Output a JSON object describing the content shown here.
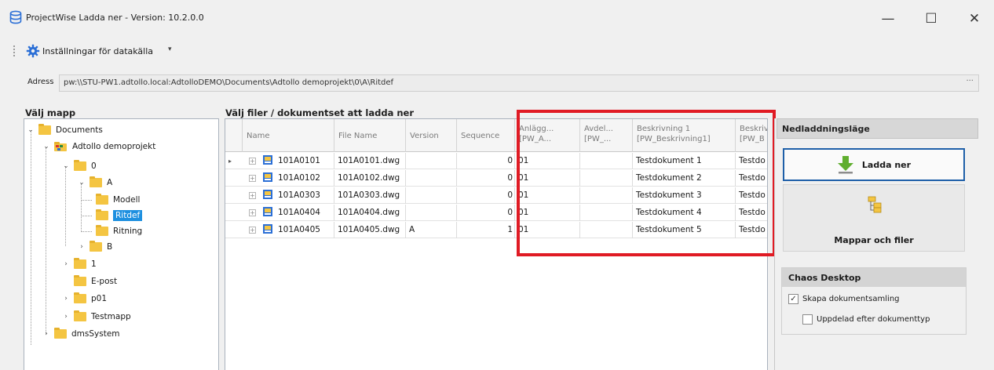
{
  "window": {
    "title": "ProjectWise Ladda ner - Version: 10.2.0.0",
    "minimize_glyph": "—",
    "maximize_glyph": "☐",
    "close_glyph": "✕"
  },
  "toolbar": {
    "settings_label": "Inställningar för datakälla",
    "dropdown_glyph": "▾"
  },
  "address": {
    "label": "Adress",
    "value": "pw:\\\\STU-PW1.adtollo.local:AdtolloDEMO\\Documents\\Adtollo demoprojekt\\0\\A\\Ritdef",
    "more_glyph": "···"
  },
  "tree": {
    "header": "Välj mapp",
    "items": [
      {
        "label": "Documents",
        "expander": "⌄",
        "icon": "folder-icon"
      },
      {
        "label": "Adtollo demoprojekt",
        "expander": "⌄",
        "icon": "project-icon"
      },
      {
        "label": "0",
        "expander": "⌄",
        "icon": "folder-icon"
      },
      {
        "label": "A",
        "expander": "⌄",
        "icon": "folder-icon"
      },
      {
        "label": "Modell",
        "expander": "",
        "icon": "folder-icon"
      },
      {
        "label": "Ritdef",
        "expander": "",
        "icon": "folder-icon",
        "selected": true
      },
      {
        "label": "Ritning",
        "expander": "",
        "icon": "folder-icon"
      },
      {
        "label": "B",
        "expander": "›",
        "icon": "folder-icon"
      },
      {
        "label": "1",
        "expander": "›",
        "icon": "folder-icon"
      },
      {
        "label": "E-post",
        "expander": "",
        "icon": "folder-icon"
      },
      {
        "label": "p01",
        "expander": "›",
        "icon": "folder-icon"
      },
      {
        "label": "Testmapp",
        "expander": "›",
        "icon": "folder-icon"
      },
      {
        "label": "dmsSystem",
        "expander": "›",
        "icon": "folder-icon"
      }
    ]
  },
  "files": {
    "header": "Välj filer / dokumentset att ladda ner",
    "columns": [
      {
        "line1": "Name",
        "line2": ""
      },
      {
        "line1": "File Name",
        "line2": ""
      },
      {
        "line1": "Version",
        "line2": ""
      },
      {
        "line1": "Sequence",
        "line2": ""
      },
      {
        "line1": "Anlägg...",
        "line2": "[PW_A..."
      },
      {
        "line1": "Avdel...",
        "line2": "[PW_..."
      },
      {
        "line1": "Beskrivning 1",
        "line2": "[PW_Beskrivning1]"
      },
      {
        "line1": "Beskriv",
        "line2": "[PW_B"
      }
    ],
    "current_row_marker": "▸",
    "expand_glyph": "+",
    "rows": [
      {
        "name": "101A0101",
        "file": "101A0101.dwg",
        "version": "",
        "sequence": "0",
        "anlagg": "01",
        "avdel": "",
        "besk1": "Testdokument 1",
        "besk2": "Testdo"
      },
      {
        "name": "101A0102",
        "file": "101A0102.dwg",
        "version": "",
        "sequence": "0",
        "anlagg": "01",
        "avdel": "",
        "besk1": "Testdokument 2",
        "besk2": "Testdo"
      },
      {
        "name": "101A0303",
        "file": "101A0303.dwg",
        "version": "",
        "sequence": "0",
        "anlagg": "01",
        "avdel": "",
        "besk1": "Testdokument 3",
        "besk2": "Testdo"
      },
      {
        "name": "101A0404",
        "file": "101A0404.dwg",
        "version": "",
        "sequence": "0",
        "anlagg": "01",
        "avdel": "",
        "besk1": "Testdokument 4",
        "besk2": "Testdo"
      },
      {
        "name": "101A0405",
        "file": "101A0405.dwg",
        "version": "A",
        "sequence": "1",
        "anlagg": "01",
        "avdel": "",
        "besk1": "Testdokument 5",
        "besk2": "Testdo"
      }
    ]
  },
  "right": {
    "header": "Nedladdningsläge",
    "download_label": "Ladda ner",
    "mode_label": "Mappar och filer",
    "chaos_title": "Chaos Desktop",
    "option1_label": "Skapa dokumentsamling",
    "option1_checked": true,
    "option2_label": "Uppdelad efter dokumenttyp",
    "option2_checked": false,
    "check_glyph": "✓"
  },
  "colors": {
    "highlight_box": "#e01b24",
    "selection": "#1e90e0",
    "download_border": "#1e5fa8",
    "folder": "#f4c542"
  }
}
